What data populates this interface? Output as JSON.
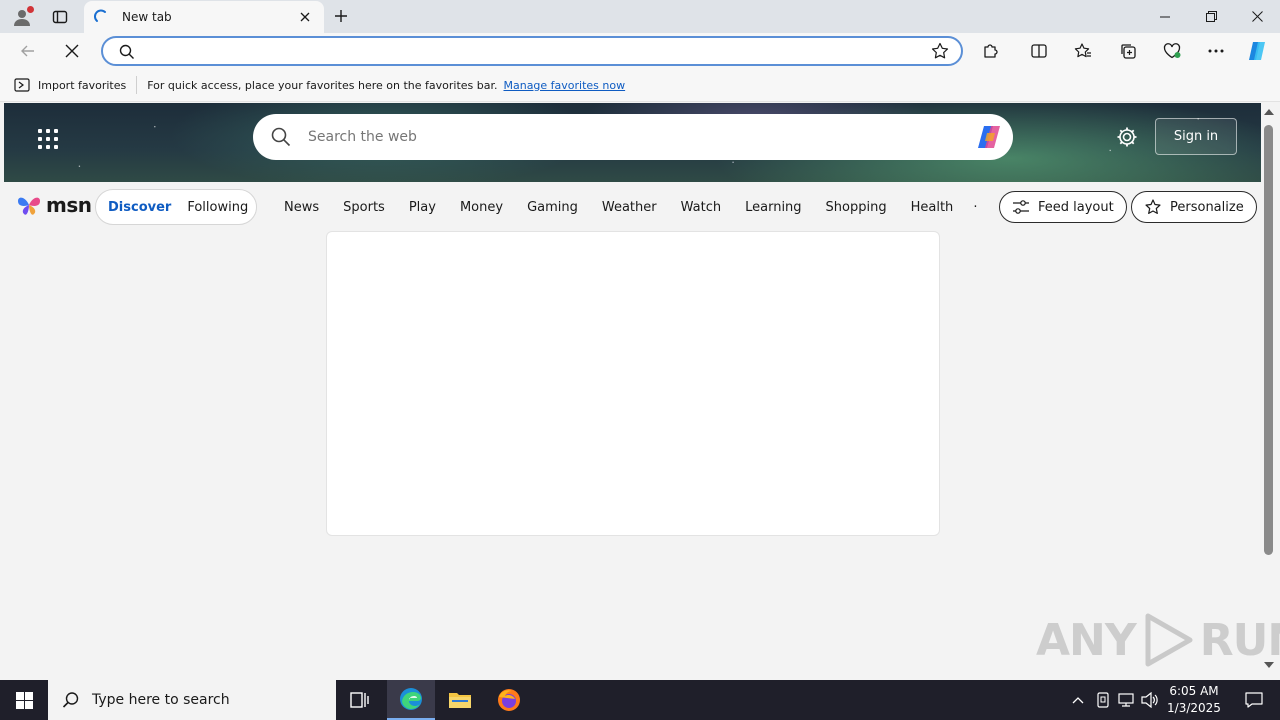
{
  "browser": {
    "tab": {
      "title": "New tab"
    },
    "address": {
      "value": "",
      "placeholder": ""
    },
    "favorites_bar": {
      "import_label": "Import favorites",
      "hint": "For quick access, place your favorites here on the favorites bar.",
      "manage_link": "Manage favorites now"
    }
  },
  "msn": {
    "search_placeholder": "Search the web",
    "sign_in": "Sign in",
    "logo_text": "msn",
    "pill_tabs": [
      {
        "label": "Discover",
        "active": true
      },
      {
        "label": "Following",
        "active": false
      }
    ],
    "nav_links": [
      "News",
      "Sports",
      "Play",
      "Money",
      "Gaming",
      "Weather",
      "Watch",
      "Learning",
      "Shopping",
      "Health"
    ],
    "nav_more": "·",
    "feed_layout": "Feed layout",
    "personalize": "Personalize"
  },
  "watermark": {
    "left": "ANY",
    "right": "RUN"
  },
  "taskbar": {
    "search_placeholder": "Type here to search",
    "time": "6:05 AM",
    "date": "1/3/2025"
  },
  "colors": {
    "accent": "#0f5cc2",
    "address_border": "#5b8fd6",
    "taskbar": "#1f1f2a",
    "notification_dot": "#d13438"
  }
}
